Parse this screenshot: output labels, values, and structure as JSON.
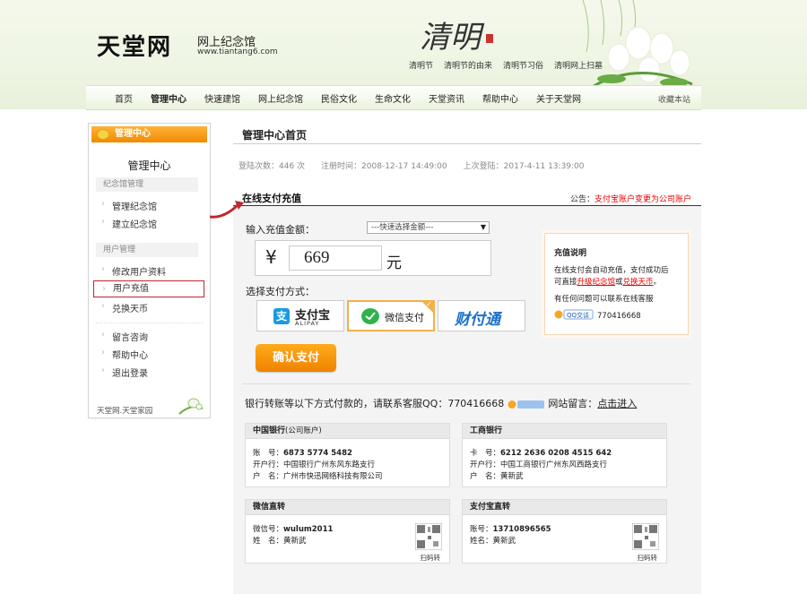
{
  "header": {
    "logo": "天堂网",
    "logo_sub": "网上纪念馆",
    "logo_url": "www.tiantang6.com",
    "qm_title": "清明",
    "qm_links": [
      "清明节",
      "清明节的由来",
      "清明节习俗",
      "清明网上扫墓"
    ]
  },
  "nav": {
    "items": [
      "首页",
      "管理中心",
      "快速建馆",
      "网上纪念馆",
      "民俗文化",
      "生命文化",
      "天堂资讯",
      "帮助中心",
      "关于天堂网"
    ],
    "active": "管理中心",
    "fav": "收藏本站"
  },
  "sidebar": {
    "head": "管理中心",
    "title": "管理中心",
    "group1": "纪念馆管理",
    "group1_items": [
      "管理纪念馆",
      "建立纪念馆"
    ],
    "group2": "用户管理",
    "group2_items": [
      "修改用户资料",
      "用户充值",
      "兑换天币"
    ],
    "group3_items": [
      "留言咨询",
      "帮助中心",
      "退出登录"
    ],
    "footer": "天堂网.天堂家园"
  },
  "main": {
    "title": "管理中心首页",
    "stats": {
      "login_count": "登陆次数：446 次",
      "reg_time": "注册时间：2008-12-17 14:49:00",
      "last_login": "上次登陆：2017-4-11 13:39:00"
    },
    "pay": {
      "title": "在线支付充值",
      "notice_prefix": "公告：",
      "notice": "支付宝账户变更为公司账户",
      "amount_label": "输入充值金额：",
      "select_placeholder": "---快速选择金额---",
      "yen": "¥",
      "amount": "669",
      "yuan": "元",
      "method_label": "选择支付方式：",
      "methods": {
        "alipay": "支付宝",
        "alipay_sub": "ALIPAY",
        "wechat": "微信支付",
        "tenpay": "财付通"
      },
      "confirm": "确认支付"
    },
    "info": {
      "title": "充值说明",
      "line1": "在线支付会自动充值，支付成功后",
      "line2_prefix": "可直接",
      "line2_link1": "升级纪念馆",
      "line2_mid": "或",
      "line2_link2": "兑换天币",
      "line2_end": "。",
      "line3": "有任何问题可以联系在线客服",
      "qq_badge": "QQ交谈",
      "qq": "770416668"
    },
    "bank_line": {
      "text": "银行转账等以下方式付款的，请联系客服QQ：770416668",
      "msg": "网站留言：",
      "link": "点击进入"
    },
    "cards": {
      "boc": {
        "title": "中国银行",
        "title_note": "(公司账户)",
        "acct_label": "账　号：",
        "acct": "6873 5774 5482",
        "bank_label": "开户行：",
        "bank": "中国银行广州东风东路支行",
        "name_label": "户　名：",
        "name": "广州市快迅网络科技有限公司"
      },
      "icbc": {
        "title": "工商银行",
        "acct_label": "卡　号：",
        "acct": "6212 2636 0208 4515 642",
        "bank_label": "开户行：",
        "bank": "中国工商银行广州东风西路支行",
        "name_label": "户　名：",
        "name": "黄新武"
      },
      "wechat": {
        "title": "微信直转",
        "acct_label": "微信号：",
        "acct": "wulum2011",
        "name_label": "姓　名：",
        "name": "黄新武",
        "scan": "扫码转"
      },
      "alipay": {
        "title": "支付宝直转",
        "acct_label": "账号：",
        "acct": "13710896565",
        "name_label": "姓名：",
        "name": "黄新武",
        "scan": "扫码转"
      }
    }
  },
  "colors": {
    "accent_orange": "#f08300",
    "notice_red": "#e00000",
    "active_border": "#c0272d"
  }
}
